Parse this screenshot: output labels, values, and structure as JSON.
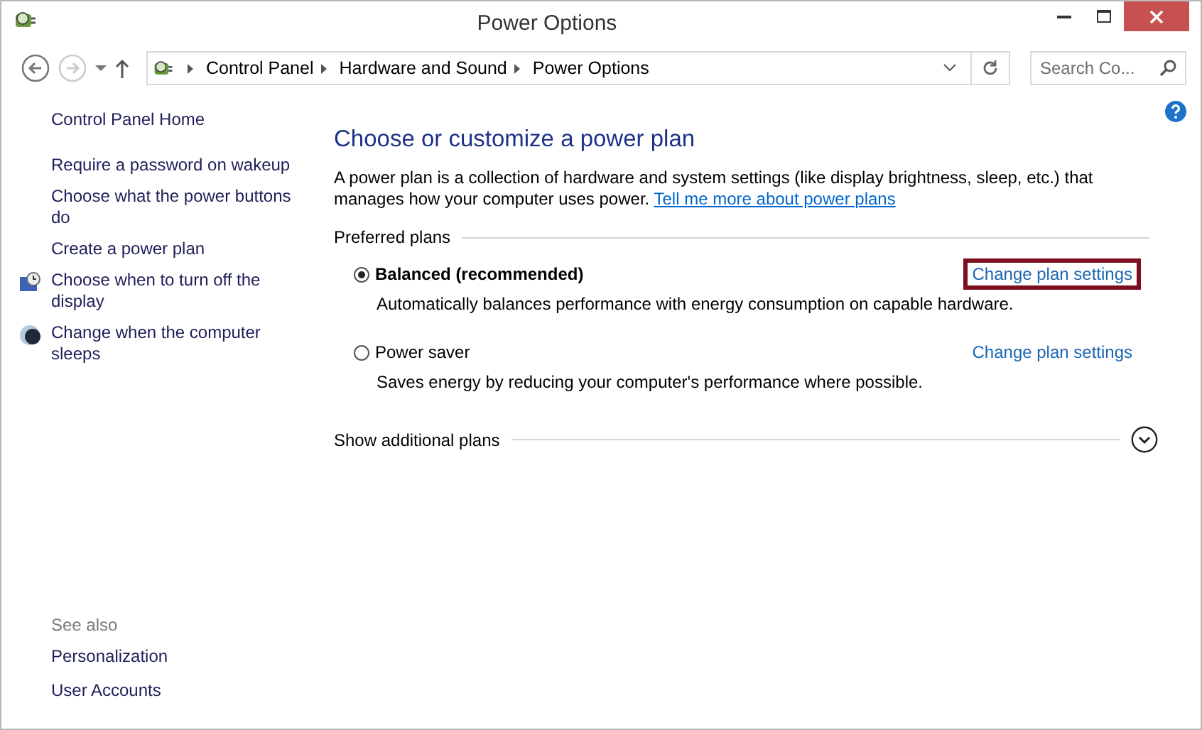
{
  "window": {
    "title": "Power Options"
  },
  "breadcrumb": [
    "Control Panel",
    "Hardware and Sound",
    "Power Options"
  ],
  "search": {
    "placeholder": "Search Co..."
  },
  "sidebar": {
    "items": [
      {
        "label": "Control Panel Home",
        "kind": "home"
      },
      {
        "label": "Require a password on wakeup",
        "kind": "plain"
      },
      {
        "label": "Choose what the power buttons do",
        "kind": "plain"
      },
      {
        "label": "Create a power plan",
        "kind": "plain"
      },
      {
        "label": "Choose when to turn off the display",
        "kind": "display"
      },
      {
        "label": "Change when the computer sleeps",
        "kind": "sleep"
      }
    ],
    "see_also": {
      "heading": "See also",
      "items": [
        "Personalization",
        "User Accounts"
      ]
    }
  },
  "main": {
    "heading": "Choose or customize a power plan",
    "intro": "A power plan is a collection of hardware and system settings (like display brightness, sleep, etc.) that manages how your computer uses power.",
    "intro_link": "Tell me more about power plans",
    "section": "Preferred plans",
    "plans": [
      {
        "name": "Balanced (recommended)",
        "selected": true,
        "description": "Automatically balances performance with energy consumption on capable hardware.",
        "link": "Change plan settings",
        "highlighted": true
      },
      {
        "name": "Power saver",
        "selected": false,
        "description": "Saves energy by reducing your computer's performance where possible.",
        "link": "Change plan settings",
        "highlighted": false
      }
    ],
    "more": "Show additional plans"
  }
}
